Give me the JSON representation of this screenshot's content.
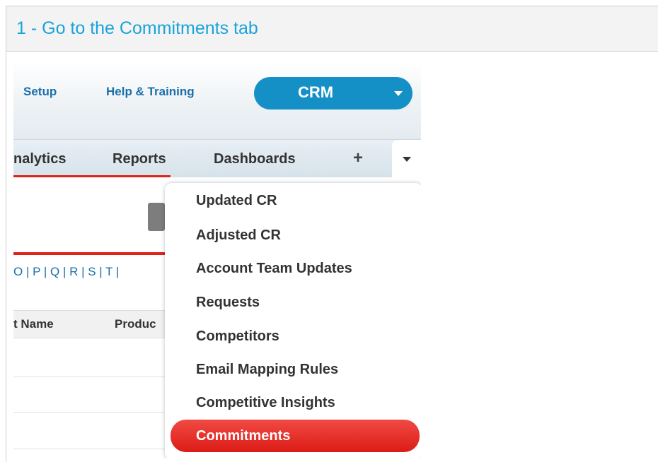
{
  "step": {
    "title": "1 - Go to the Commitments tab"
  },
  "top_links": [
    "Setup",
    "Help & Training"
  ],
  "app_switcher": {
    "label": "CRM",
    "caret_icon": "caret-down-icon"
  },
  "tabs": [
    "nalytics",
    "Reports",
    "Dashboards"
  ],
  "tab_add_icon": "+",
  "tab_more_icon": "caret-down-icon",
  "alphabet_filter": "O | P | Q | R | S | T |",
  "table_headers": [
    "t Name",
    "Produc"
  ],
  "menu": {
    "items": [
      "Updated CR",
      "Adjusted CR",
      "Account Team Updates",
      "Requests",
      "Competitors",
      "Email Mapping Rules",
      "Competitive Insights",
      "Commitments"
    ],
    "selected": "Commitments"
  },
  "colors": {
    "accent": "#19a3d9",
    "brand": "#1590c6",
    "highlight": "#e0221b"
  }
}
